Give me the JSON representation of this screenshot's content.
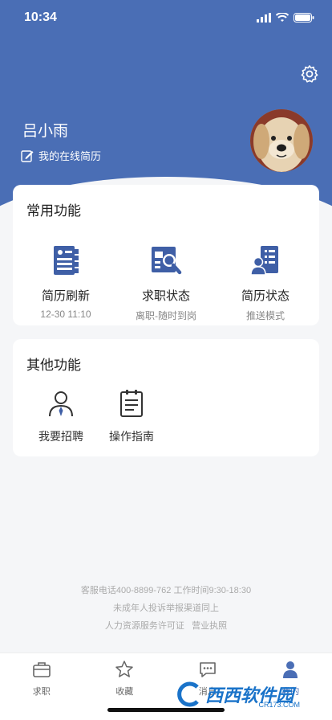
{
  "status_bar": {
    "time": "10:34"
  },
  "profile": {
    "name": "吕小雨",
    "resume_link": "我的在线简历"
  },
  "common": {
    "title": "常用功能",
    "items": [
      {
        "label": "简历刷新",
        "sub": "12-30 11:10",
        "icon": "resume-refresh-icon"
      },
      {
        "label": "求职状态",
        "sub": "离职-随时到岗",
        "icon": "job-search-icon"
      },
      {
        "label": "简历状态",
        "sub": "推送模式",
        "icon": "resume-status-icon"
      }
    ]
  },
  "other": {
    "title": "其他功能",
    "items": [
      {
        "label": "我要招聘",
        "icon": "recruit-person-icon"
      },
      {
        "label": "操作指南",
        "icon": "guide-document-icon"
      }
    ]
  },
  "footer": {
    "line1": "客服电话400-8899-762 工作时间9:30-18:30",
    "line2": "未成年人投诉举报渠道同上",
    "line3a": "人力资源服务许可证",
    "line3b": "营业执照"
  },
  "tabs": [
    {
      "label": "求职",
      "icon": "briefcase-icon"
    },
    {
      "label": "收藏",
      "icon": "star-icon"
    },
    {
      "label": "消息",
      "icon": "chat-icon"
    },
    {
      "label": "我的",
      "icon": "person-icon"
    }
  ],
  "watermark": {
    "text": "西西软件园",
    "sub": "CR173.COM"
  },
  "colors": {
    "brand": "#4a6eb5",
    "icon_blue": "#3f5fa6"
  }
}
